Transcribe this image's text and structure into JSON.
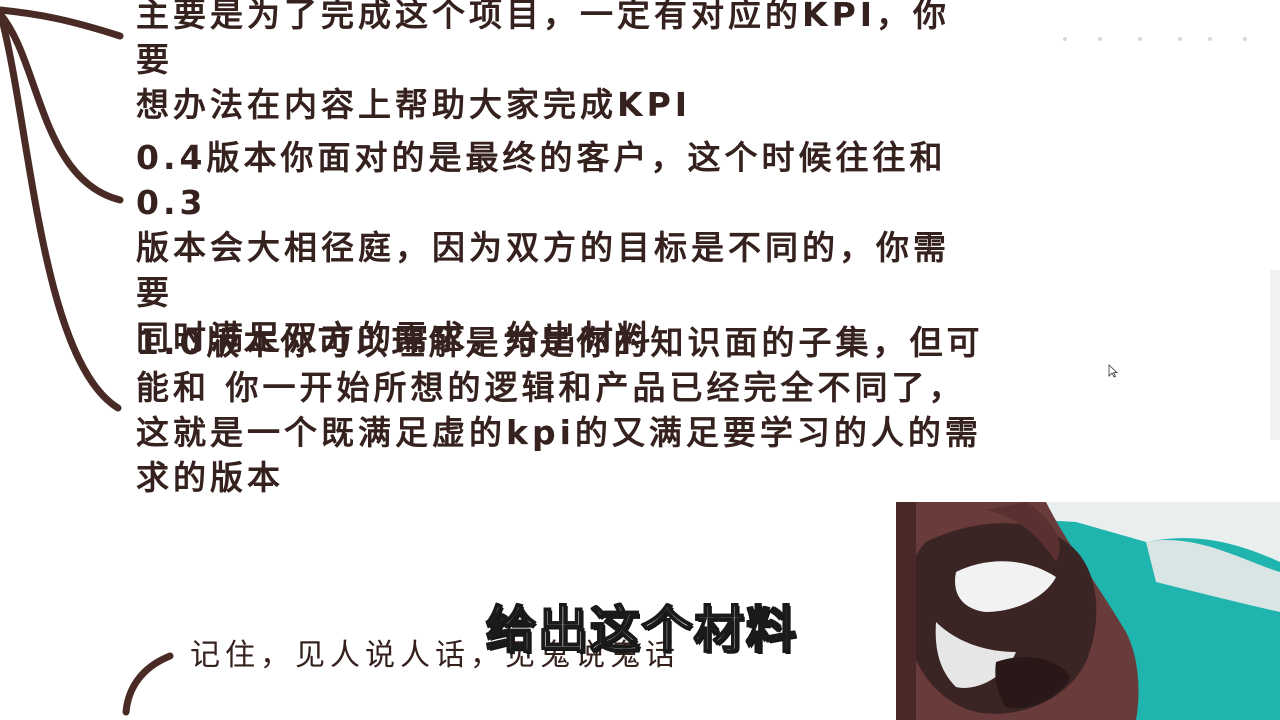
{
  "notes": {
    "kpi": "主要是为了完成这个项目，一定有对应的KPI，你要\n想办法在内容上帮助大家完成KPI",
    "version_04": "0.4版本你面对的是最终的客户，这个时候往往和0.3\n版本会大相径庭，因为双方的目标是不同的，你需要\n同时满足双方的需求，给出材料",
    "version_10": "1.0版本你可以理解是为是你的知识面的子集，但可\n能和 你一开始所想的逻辑和产品已经完全不同了，\n这就是一个既满足虚的kpi的又满足要学习的人的需\n求的版本",
    "remember": "记住，见人说人话，见鬼说鬼话"
  },
  "subtitle": "给出这个材料",
  "colors": {
    "text": "#35211d",
    "branch": "#4a2a24",
    "background": "#ffffff",
    "webcam_bg": "#20b8b0"
  },
  "icons": {
    "cursor": "mouse-pointer-icon"
  }
}
